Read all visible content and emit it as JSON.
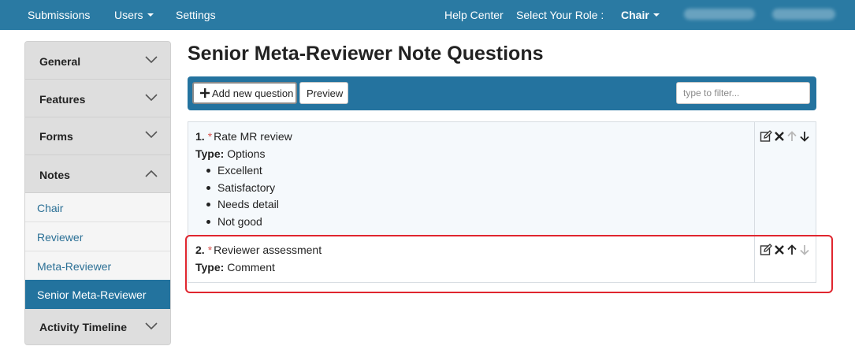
{
  "topnav": {
    "items": [
      {
        "label": "Submissions"
      },
      {
        "label": "Users"
      },
      {
        "label": "Settings"
      }
    ],
    "help_center": "Help Center",
    "role_label": "Select Your Role :",
    "role_value": "Chair"
  },
  "sidebar": {
    "sections": [
      {
        "label": "General"
      },
      {
        "label": "Features"
      },
      {
        "label": "Forms"
      },
      {
        "label": "Notes"
      },
      {
        "label": "Activity Timeline"
      }
    ],
    "notes_items": [
      {
        "label": "Chair"
      },
      {
        "label": "Reviewer"
      },
      {
        "label": "Meta-Reviewer"
      },
      {
        "label": "Senior Meta-Reviewer"
      }
    ]
  },
  "main": {
    "title": "Senior Meta-Reviewer Note Questions",
    "toolbar": {
      "add_label": "Add new question",
      "preview_label": "Preview",
      "filter_placeholder": "type to filter..."
    },
    "questions": [
      {
        "number": "1.",
        "required_mark": "*",
        "text": "Rate MR review",
        "type_label": "Type:",
        "type_value": "Options",
        "options": [
          "Excellent",
          "Satisfactory",
          "Needs detail",
          "Not good"
        ]
      },
      {
        "number": "2.",
        "required_mark": "*",
        "text": "Reviewer assessment",
        "type_label": "Type:",
        "type_value": "Comment"
      }
    ]
  },
  "colors": {
    "topbar": "#2a7aa3",
    "toolbar": "#24739f",
    "active_sidebar": "#23739e",
    "link": "#2a6f95",
    "required": "#d9534f",
    "highlight": "#e0262f"
  }
}
